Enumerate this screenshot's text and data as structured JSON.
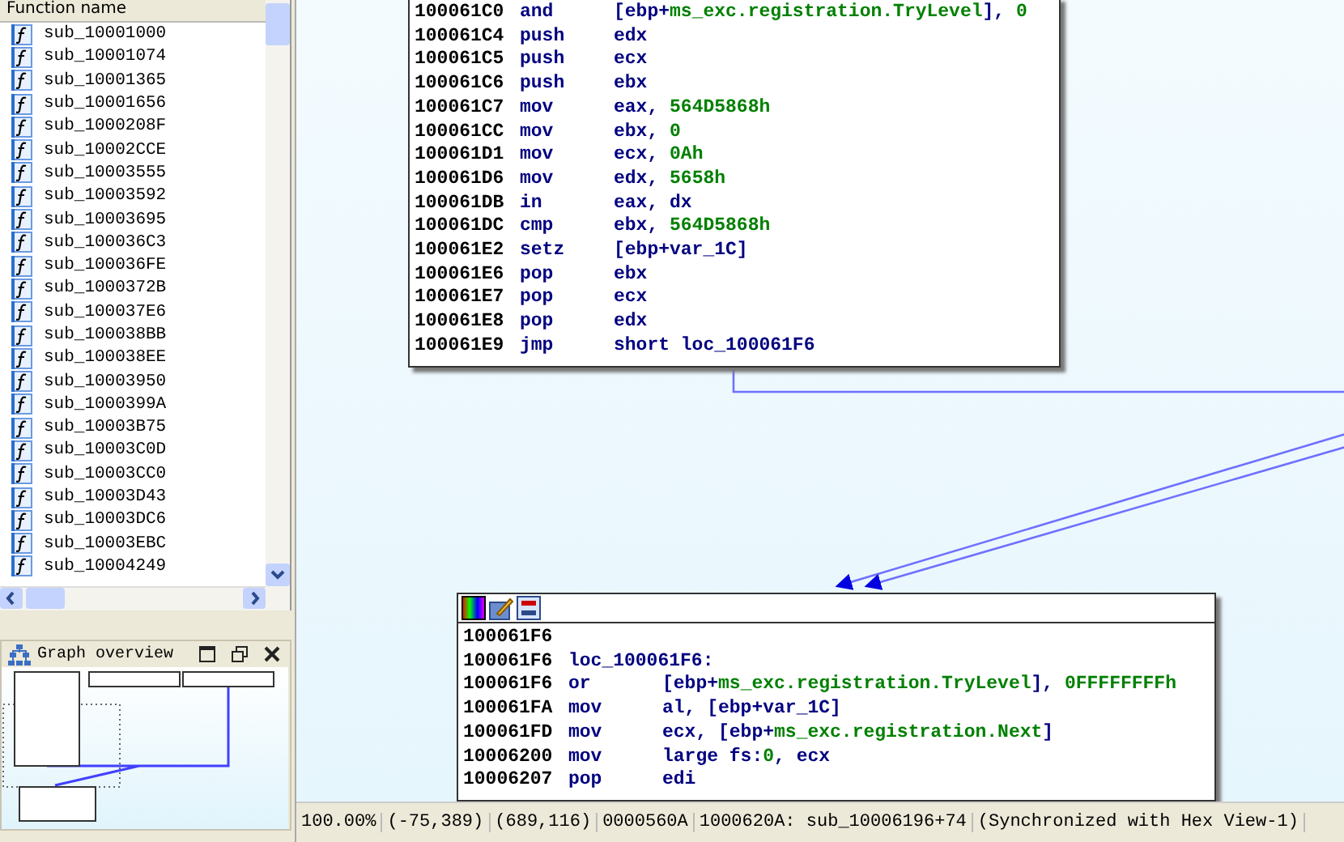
{
  "function_list": {
    "header": "Function name",
    "items": [
      "sub_10001000",
      "sub_10001074",
      "sub_10001365",
      "sub_10001656",
      "sub_1000208F",
      "sub_10002CCE",
      "sub_10003555",
      "sub_10003592",
      "sub_10003695",
      "sub_100036C3",
      "sub_100036FE",
      "sub_1000372B",
      "sub_100037E6",
      "sub_100038BB",
      "sub_100038EE",
      "sub_10003950",
      "sub_1000399A",
      "sub_10003B75",
      "sub_10003C0D",
      "sub_10003CC0",
      "sub_10003D43",
      "sub_10003DC6",
      "sub_10003EBC",
      "sub_10004249"
    ]
  },
  "graph_overview": {
    "title": "Graph overview"
  },
  "graph": {
    "blocks": [
      {
        "has_toolbar": false,
        "lines": [
          {
            "kind": "instr",
            "address": "100061C0",
            "mnemonic": "and",
            "operands": [
              {
                "kind": "code",
                "text": "[ebp+"
              },
              {
                "kind": "num",
                "text": "ms_exc.registration.TryLevel"
              },
              {
                "kind": "code",
                "text": "], "
              },
              {
                "kind": "num",
                "text": "0"
              }
            ]
          },
          {
            "kind": "instr",
            "address": "100061C4",
            "mnemonic": "push",
            "operands": [
              {
                "kind": "code",
                "text": "edx"
              }
            ]
          },
          {
            "kind": "instr",
            "address": "100061C5",
            "mnemonic": "push",
            "operands": [
              {
                "kind": "code",
                "text": "ecx"
              }
            ]
          },
          {
            "kind": "instr",
            "address": "100061C6",
            "mnemonic": "push",
            "operands": [
              {
                "kind": "code",
                "text": "ebx"
              }
            ]
          },
          {
            "kind": "instr",
            "address": "100061C7",
            "mnemonic": "mov",
            "operands": [
              {
                "kind": "code",
                "text": "eax, "
              },
              {
                "kind": "num",
                "text": "564D5868h"
              }
            ]
          },
          {
            "kind": "instr",
            "address": "100061CC",
            "mnemonic": "mov",
            "operands": [
              {
                "kind": "code",
                "text": "ebx, "
              },
              {
                "kind": "num",
                "text": "0"
              }
            ]
          },
          {
            "kind": "instr",
            "address": "100061D1",
            "mnemonic": "mov",
            "operands": [
              {
                "kind": "code",
                "text": "ecx, "
              },
              {
                "kind": "num",
                "text": "0Ah"
              }
            ]
          },
          {
            "kind": "instr",
            "address": "100061D6",
            "mnemonic": "mov",
            "operands": [
              {
                "kind": "code",
                "text": "edx, "
              },
              {
                "kind": "num",
                "text": "5658h"
              }
            ]
          },
          {
            "kind": "instr",
            "address": "100061DB",
            "mnemonic": "in",
            "operands": [
              {
                "kind": "code",
                "text": "eax, dx"
              }
            ]
          },
          {
            "kind": "instr",
            "address": "100061DC",
            "mnemonic": "cmp",
            "operands": [
              {
                "kind": "code",
                "text": "ebx, "
              },
              {
                "kind": "num",
                "text": "564D5868h"
              }
            ]
          },
          {
            "kind": "instr",
            "address": "100061E2",
            "mnemonic": "setz",
            "operands": [
              {
                "kind": "code",
                "text": "[ebp+var_1C]"
              }
            ]
          },
          {
            "kind": "instr",
            "address": "100061E6",
            "mnemonic": "pop",
            "operands": [
              {
                "kind": "code",
                "text": "ebx"
              }
            ]
          },
          {
            "kind": "instr",
            "address": "100061E7",
            "mnemonic": "pop",
            "operands": [
              {
                "kind": "code",
                "text": "ecx"
              }
            ]
          },
          {
            "kind": "instr",
            "address": "100061E8",
            "mnemonic": "pop",
            "operands": [
              {
                "kind": "code",
                "text": "edx"
              }
            ]
          },
          {
            "kind": "instr",
            "address": "100061E9",
            "mnemonic": "jmp",
            "operands": [
              {
                "kind": "code",
                "text": "short loc_100061F6"
              }
            ]
          }
        ]
      },
      {
        "has_toolbar": true,
        "lines": [
          {
            "kind": "address",
            "address": "100061F6"
          },
          {
            "kind": "label",
            "address": "100061F6",
            "label": "loc_100061F6:"
          },
          {
            "kind": "instr",
            "address": "100061F6",
            "mnemonic": "or",
            "operands": [
              {
                "kind": "code",
                "text": "[ebp+"
              },
              {
                "kind": "num",
                "text": "ms_exc.registration.TryLevel"
              },
              {
                "kind": "code",
                "text": "], "
              },
              {
                "kind": "num",
                "text": "0FFFFFFFFh"
              }
            ]
          },
          {
            "kind": "instr",
            "address": "100061FA",
            "mnemonic": "mov",
            "operands": [
              {
                "kind": "code",
                "text": "al, [ebp+var_1C]"
              }
            ]
          },
          {
            "kind": "instr",
            "address": "100061FD",
            "mnemonic": "mov",
            "operands": [
              {
                "kind": "code",
                "text": "ecx, [ebp+"
              },
              {
                "kind": "num",
                "text": "ms_exc.registration.Next"
              },
              {
                "kind": "code",
                "text": "]"
              }
            ]
          },
          {
            "kind": "instr",
            "address": "10006200",
            "mnemonic": "mov",
            "operands": [
              {
                "kind": "code",
                "text": "large fs:"
              },
              {
                "kind": "num",
                "text": "0"
              },
              {
                "kind": "code",
                "text": ", ecx"
              }
            ]
          },
          {
            "kind": "instr",
            "address": "10006207",
            "mnemonic": "pop",
            "operands": [
              {
                "kind": "code",
                "text": "edi"
              }
            ]
          }
        ]
      }
    ]
  },
  "status_bar": [
    "100.00%",
    "(-75,389)",
    "(689,116)",
    "0000560A",
    "1000620A: sub_10006196+74",
    "(Synchronized with Hex View-1)"
  ]
}
